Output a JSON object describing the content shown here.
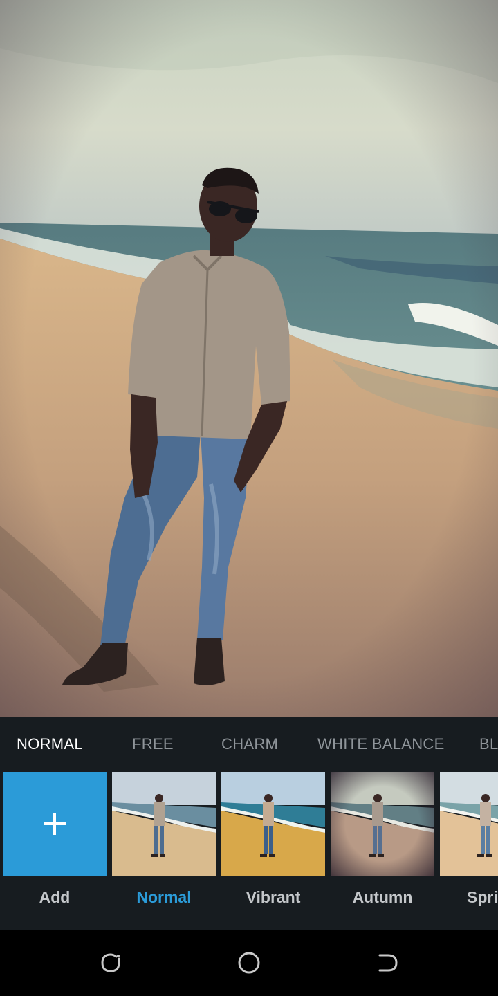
{
  "filter_tabs": [
    {
      "label": "NORMAL",
      "active": true
    },
    {
      "label": "FREE",
      "active": false
    },
    {
      "label": "CHARM",
      "active": false
    },
    {
      "label": "WHITE BALANCE",
      "active": false
    },
    {
      "label": "BL",
      "active": false
    }
  ],
  "add_tile": {
    "label": "Add",
    "icon": "plus-icon"
  },
  "presets": [
    {
      "label": "Normal",
      "selected": true
    },
    {
      "label": "Vibrant",
      "selected": false
    },
    {
      "label": "Autumn",
      "selected": false
    },
    {
      "label": "Spri",
      "selected": false
    }
  ],
  "nav": {
    "recents_icon": "recent-apps-icon",
    "home_icon": "home-icon",
    "back_icon": "back-icon"
  },
  "colors": {
    "accent": "#2b9bd8",
    "panel_bg": "#171c20",
    "inactive_tab": "#8f959a"
  }
}
